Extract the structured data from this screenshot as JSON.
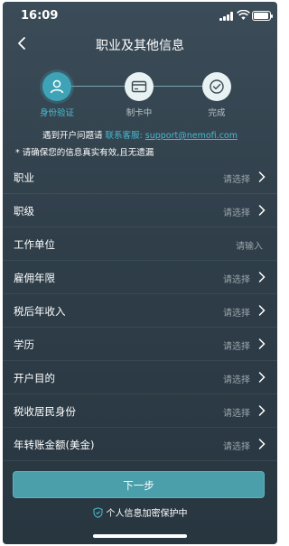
{
  "status_bar": {
    "time": "16:09"
  },
  "nav": {
    "title": "职业及其他信息"
  },
  "stepper": {
    "steps": [
      {
        "label": "身份验证",
        "state": "active"
      },
      {
        "label": "制卡中",
        "state": "pending"
      },
      {
        "label": "完成",
        "state": "pending"
      }
    ]
  },
  "help": {
    "prefix": "遇到开户问题请",
    "link_label": "联系客服:",
    "email": "support@nemofi.com"
  },
  "notice": "* 请确保您的信息真实有效,且无遗漏",
  "form": {
    "rows": [
      {
        "label": "职业",
        "value": "请选择"
      },
      {
        "label": "职级",
        "value": "请选择"
      },
      {
        "label": "工作单位",
        "value": "请输入"
      },
      {
        "label": "雇佣年限",
        "value": "请选择"
      },
      {
        "label": "税后年收入",
        "value": "请选择"
      },
      {
        "label": "学历",
        "value": "请选择"
      },
      {
        "label": "开户目的",
        "value": "请选择"
      },
      {
        "label": "税收居民身份",
        "value": "请选择"
      },
      {
        "label": "年转账金额(美金)",
        "value": "请选择"
      }
    ]
  },
  "next_button": {
    "label": "下一步"
  },
  "privacy": {
    "text": "个人信息加密保护中"
  },
  "colors": {
    "accent": "#3fa3b7",
    "link": "#48b9cf",
    "button": "#4a9fab"
  }
}
